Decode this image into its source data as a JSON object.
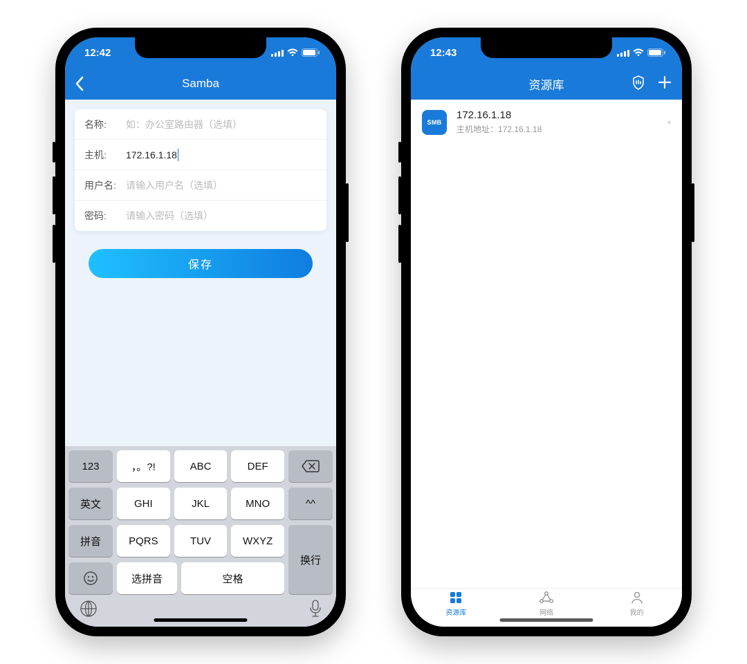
{
  "colors": {
    "accent": "#1a7ad9"
  },
  "left_phone": {
    "status": {
      "time": "12:42"
    },
    "nav": {
      "title": "Samba"
    },
    "form": {
      "name_label": "名称:",
      "name_placeholder": "如：办公室路由器（选填）",
      "host_label": "主机:",
      "host_value": "172.16.1.18",
      "user_label": "用户名:",
      "user_placeholder": "请输入用户名（选填）",
      "pass_label": "密码:",
      "pass_placeholder": "请输入密码（选填）"
    },
    "save_button": "保存",
    "keyboard": {
      "left_col": [
        "123",
        "英文",
        "拼音",
        "☺"
      ],
      "rows": [
        [
          "，。?!",
          "ABC",
          "DEF"
        ],
        [
          "GHI",
          "JKL",
          "MNO"
        ],
        [
          "PQRS",
          "TUV",
          "WXYZ"
        ]
      ],
      "bottom_left": "选拼音",
      "bottom_right": "空格",
      "right_backspace": "⌫",
      "right_smile": "^^",
      "right_enter": "换行",
      "globe_icon": "globe",
      "mic_icon": "mic"
    }
  },
  "right_phone": {
    "status": {
      "time": "12:43"
    },
    "nav": {
      "title": "资源库"
    },
    "item": {
      "badge": "SMB",
      "title": "172.16.1.18",
      "subtitle_label": "主机地址：",
      "subtitle_value": "172.16.1.18"
    },
    "tabs": [
      {
        "label": "资源库",
        "icon": "library",
        "active": true
      },
      {
        "label": "网络",
        "icon": "network",
        "active": false
      },
      {
        "label": "我的",
        "icon": "profile",
        "active": false
      }
    ]
  }
}
